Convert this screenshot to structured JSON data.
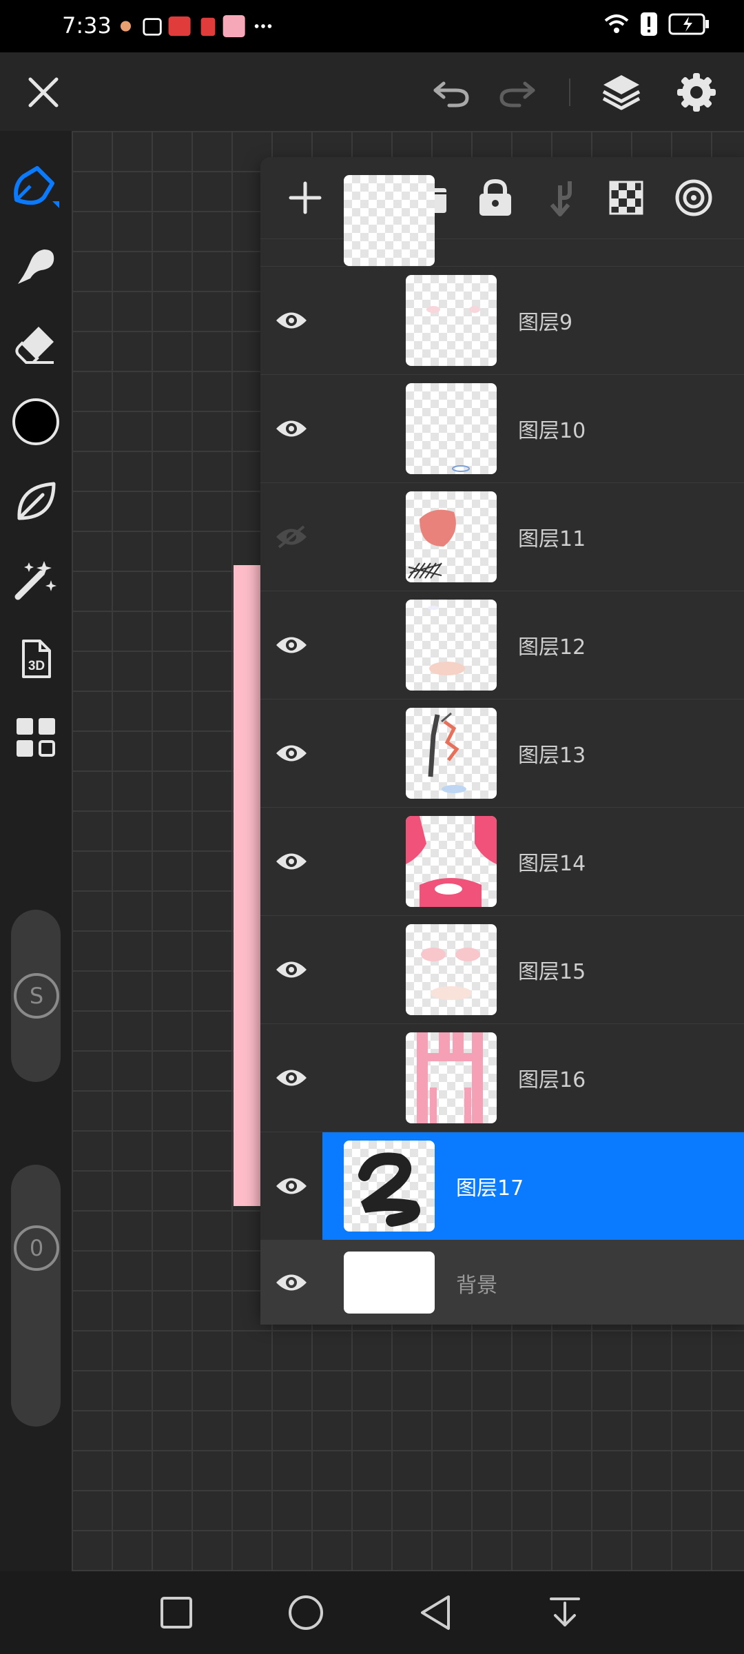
{
  "status_bar": {
    "time": "7:33"
  },
  "colors": {
    "accent": "#0a7aff",
    "canvas_paper": "#ffbdca",
    "brush_color": "#000000"
  },
  "sidebar": {
    "tools": [
      "brush-tool-icon",
      "smudge-tool-icon",
      "eraser-tool-icon",
      "color-swatch",
      "leaf-icon",
      "magic-wand-icon",
      "3d-icon",
      "gallery-grid-icon"
    ],
    "size_badge": "S",
    "opacity_badge": "0"
  },
  "layers_panel": {
    "layers": [
      {
        "name": "图层9",
        "visible": true,
        "active": false
      },
      {
        "name": "图层10",
        "visible": true,
        "active": false
      },
      {
        "name": "图层11",
        "visible": false,
        "active": false
      },
      {
        "name": "图层12",
        "visible": true,
        "active": false
      },
      {
        "name": "图层13",
        "visible": true,
        "active": false
      },
      {
        "name": "图层14",
        "visible": true,
        "active": false
      },
      {
        "name": "图层15",
        "visible": true,
        "active": false
      },
      {
        "name": "图层16",
        "visible": true,
        "active": false
      },
      {
        "name": "图层17",
        "visible": true,
        "active": true
      }
    ],
    "background": {
      "name": "背景",
      "visible": true
    }
  }
}
